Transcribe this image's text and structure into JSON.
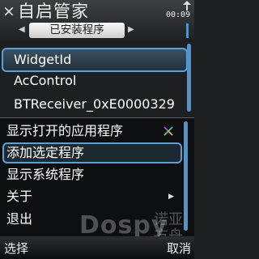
{
  "header": {
    "close_glyph": "×",
    "title": "自启管家",
    "clock": "00:09",
    "tab_label": "已安装程序"
  },
  "list": {
    "items": [
      {
        "label": "WidgetId",
        "selected": true
      },
      {
        "label": "AcControl",
        "selected": false
      },
      {
        "label": "BTReceiver_0xE0000329",
        "selected": false
      }
    ]
  },
  "options_menu": {
    "items": [
      {
        "label": "显示打开的应用程序",
        "icon": "app-switch-icon"
      },
      {
        "label": "添加选定程序",
        "selected": true
      },
      {
        "label": "显示系统程序"
      },
      {
        "label": "关于",
        "has_submenu": true
      },
      {
        "label": "退出"
      }
    ]
  },
  "watermark": {
    "text": "Dospy",
    "text_cn": "诺亚方舟"
  },
  "softkeys": {
    "left": "选择",
    "right": "取消"
  },
  "colors": {
    "accent": "#5aa1d8",
    "scrollbar": "#4f93cf",
    "background": "#1d2022"
  }
}
